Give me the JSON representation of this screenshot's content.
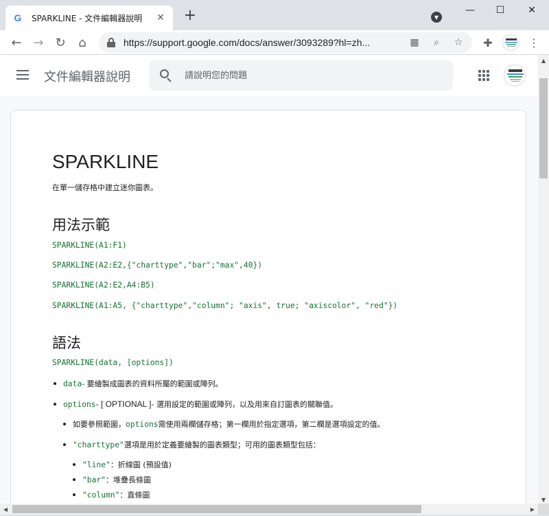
{
  "browser": {
    "tab_title": "SPARKLINE - 文件編輯器說明",
    "tab_favicon": "G",
    "url": "https://support.google.com/docs/answer/3093289?hl=zh...",
    "accent": "#4285f4"
  },
  "header": {
    "app_title": "文件編輯器說明",
    "search_placeholder": "請說明您的問題"
  },
  "article": {
    "title": "SPARKLINE",
    "intro": "在單一儲存格中建立迷你圖表。",
    "usage_heading": "用法示範",
    "examples": [
      "SPARKLINE(A1:F1)",
      "SPARKLINE(A2:E2,{\"charttype\",\"bar\";\"max\",40})",
      "SPARKLINE(A2:E2,A4:B5)",
      "SPARKLINE(A1:A5, {\"charttype\",\"column\"; \"axis\", true; \"axiscolor\", \"red\"})"
    ],
    "syntax_heading": "語法",
    "syntax": "SPARKLINE(data, [options])",
    "params": {
      "data_name": "data",
      "data_desc": " - 要繪製成圖表的資料所屬的範圍或陣列。",
      "options_name": "options",
      "options_optional": " - [ OPTIONAL ] ",
      "options_desc": "- 選用設定的範圍或陣列，以及用來自訂圖表的關聯值。",
      "sub1_pre": "如要參照範圍，",
      "sub1_code": "options",
      "sub1_post": " 需使用兩欄儲存格；第一欄用於指定選項，第二欄是選項設定的值。",
      "sub2_code": "\"charttype\"",
      "sub2_post": " 選項是用於定義要繪製的圖表類型；可用的圖表類型包括：",
      "types": [
        {
          "code": "\"line\"",
          "desc": "：折線圖 (預設值)"
        },
        {
          "code": "\"bar\"",
          "desc": "：堆疊長條圖"
        },
        {
          "code": "\"column\"",
          "desc": "：直條圖"
        }
      ]
    },
    "code_color": "#137333"
  }
}
